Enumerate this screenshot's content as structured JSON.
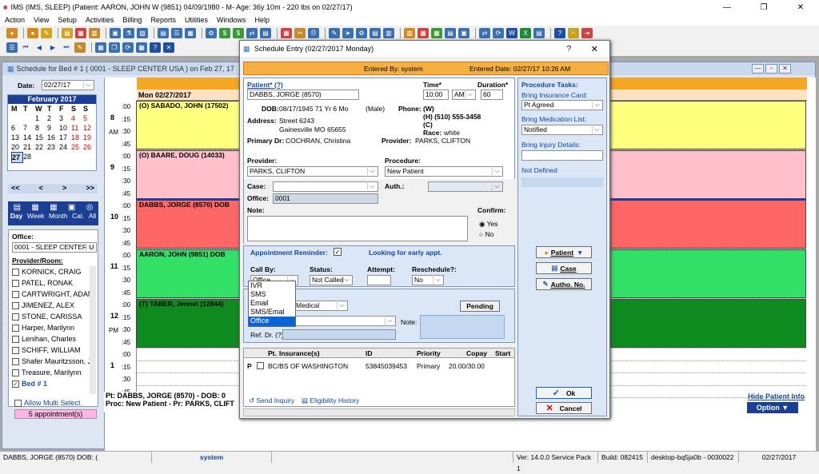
{
  "app_title": "IMS (IMS, SLEEP)   (Patient: AARON, JOHN W (9851) 04/09/1980 - M- Age: 36y 10m - 220 lbs on 02/27/17)",
  "menu": [
    "Action",
    "View",
    "Setup",
    "Activities",
    "Billing",
    "Reports",
    "Utilities",
    "Windows",
    "Help"
  ],
  "schedule": {
    "window_title": "Schedule for Bed # 1 ( 0001 - SLEEP CENTER USA )  on  Feb 27, 17",
    "date_label": "Date:",
    "date_value": "02/27/17",
    "day_header": "Mon 02/27/2017",
    "calendar": {
      "month": "February 2017",
      "weekdays": [
        "M",
        "T",
        "W",
        "T",
        "F",
        "S",
        "S"
      ],
      "weeks": [
        [
          "",
          "",
          "1",
          "2",
          "3",
          "4",
          "5"
        ],
        [
          "6",
          "7",
          "8",
          "9",
          "10",
          "11",
          "12"
        ],
        [
          "13",
          "14",
          "15",
          "16",
          "17",
          "18",
          "19"
        ],
        [
          "20",
          "21",
          "22",
          "23",
          "24",
          "25",
          "26"
        ],
        [
          "27",
          "28",
          "",
          "",
          "",
          "",
          ""
        ]
      ],
      "nav": [
        "<<",
        "<",
        ">",
        ">>"
      ]
    },
    "views": [
      "Day",
      "Week",
      "Month",
      "Cal.",
      "All"
    ],
    "office_label": "Office:",
    "office_value": "0001 - SLEEP CENTER U",
    "provider_label": "Provider/Room:",
    "providers": [
      "KORNICK, CRAIG",
      "PATEL, RONAK",
      "CARTWRIGHT, ADAM",
      "JIMENEZ, ALEX",
      "STONE, CARISSA",
      "Harper, Marilynn",
      "Lenihan, Charles",
      "SCHIFF, WILLIAM",
      "Shafer Mauritzsson, Ja",
      "Treasure, Marilynn",
      "Bed # 1"
    ],
    "allow_multi": "Allow Multi Select",
    "appointments_count": "5 appointment(s)",
    "hours": [
      "8",
      "9",
      "10",
      "11",
      "12",
      "1"
    ],
    "am": "AM",
    "pm": "PM",
    "quarters": [
      ":00",
      ":15",
      ":30",
      ":45"
    ],
    "appointments": [
      {
        "text": "(O)  SABADO, JOHN  (17502)",
        "color": "#ffff80"
      },
      {
        "text": "(O)  BAARE, DOUG  (14033)",
        "color": "#ffc0cb"
      },
      {
        "text": "DABBS, JORGE  (8570)  DOB",
        "color": "#ff6666"
      },
      {
        "text": "AARON, JOHN  (9851)  DOB",
        "color": "#33e066"
      },
      {
        "text": "(T)  TABER, Jennet  (12844)",
        "color": "#0f8a1e"
      }
    ],
    "footer_line1": "Pt: DABBS, JORGE  (8570) - DOB: 0",
    "footer_line2": "Proc: New Patient - Pr: PARKS, CLIFT",
    "hide_patient_info": "Hide Patient Info",
    "option_button": "Option"
  },
  "dialog": {
    "title": "Schedule Entry (02/27/2017 Monday)",
    "help": "?",
    "close": "✕",
    "entered_by": "Entered By: system",
    "entered_date": "Entered Date: 02/27/17 10:26 AM",
    "patient_label": "Patient* (?)",
    "patient_value": "DABBS, JORGE  (8570)",
    "time_label": "Time*",
    "time_value": "10:00",
    "ampm": "AM",
    "duration_label": "Duration*",
    "duration_value": "60",
    "dob_label": "DOB:",
    "dob_value": "08/17/1945 71 Yr 6 Mo",
    "gender": "(Male)",
    "phone_label": "Phone:",
    "phone_w": "(W)",
    "phone_h": "(H)  (510)  555-3458",
    "phone_c": "(C)",
    "address_label": "Address:",
    "address_line1": "Street 6243",
    "address_line2": "Gainesville  MO  65655",
    "race_label": "Race:",
    "race_value": "white",
    "primary_dr_label": "Primary Dr:",
    "primary_dr_value": "COCHRAN, Christina",
    "provider_info_label": "Provider:",
    "provider_info_value": "PARKS, CLIFTON",
    "provider_label": "Provider:",
    "provider_value": "PARKS, CLIFTON",
    "procedure_label": "Procedure:",
    "procedure_value": "New Patient",
    "case_label": "Case:",
    "auth_label": "Auth.:",
    "office_label": "Office:",
    "office_value": "0001",
    "note_label": "Note:",
    "confirm_label": "Confirm:",
    "confirm_yes": "Yes",
    "confirm_no": "No",
    "reminder_label": "Appointment Reminder:",
    "early_appt": "Looking for early appt.",
    "callby_label": "Call By:",
    "callby_value": "Office",
    "callby_options": [
      "IVR",
      "SMS",
      "Email",
      "SMS/Emal",
      "Office"
    ],
    "status_label": "Status:",
    "status_value": "Not Called",
    "attempt_label": "Attempt:",
    "reschedule_label": "Reschedule?:",
    "reschedule_value": "No",
    "medical_value": "Medical",
    "pending": "Pending",
    "note2_label": "Note:",
    "ref_dr_label": "Ref. Dr. (?)",
    "insurance_headers": [
      "Pt.",
      "Insurance(s)",
      "ID",
      "Priority",
      "Copay",
      "Start"
    ],
    "insurance_rows": [
      {
        "p": "P",
        "name": "BC/BS OF WASHINGTON",
        "id": "53845039453",
        "priority": "Primary",
        "copay": "20.00/30.00"
      }
    ],
    "send_inquiry": "Send Inquiry",
    "eligibility_history": "Eligibility History",
    "tasks_title": "Procedure Tasks:",
    "task_ins_label": "Bring Insurance Card:",
    "task_ins_value": "Pt Agreed",
    "task_med_label": "Bring Medication List:",
    "task_med_value": "Notified",
    "task_injury_label": "Bring Injury Details:",
    "not_defined": "Not Defined",
    "patient_btn": "Patient",
    "case_btn": "Case",
    "autho_btn": "Autho. No.",
    "ok_btn": "Ok",
    "cancel_btn": "Cancel"
  },
  "status": {
    "patient": "DABBS, JORGE  (8570) DOB: (",
    "user": "system",
    "version": "Ver: 14.0.0 Service Pack 1",
    "build": "Build: 082415",
    "machine": "desktop-bq5ja0b - 0030022",
    "date": "02/27/2017"
  }
}
